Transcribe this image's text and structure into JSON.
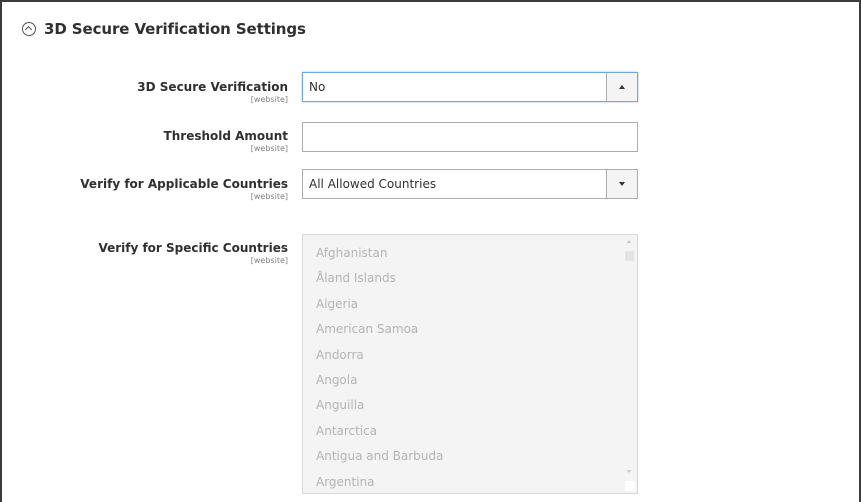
{
  "section": {
    "title": "3D Secure Verification Settings",
    "collapse_icon": "collapse-circle-up-icon"
  },
  "fields": {
    "secure_verification": {
      "label": "3D Secure Verification",
      "scope": "[website]",
      "value": "No",
      "state": "open/focused"
    },
    "threshold_amount": {
      "label": "Threshold Amount",
      "scope": "[website]",
      "value": ""
    },
    "applicable_countries": {
      "label": "Verify for Applicable Countries",
      "scope": "[website]",
      "value": "All Allowed Countries"
    },
    "specific_countries": {
      "label": "Verify for Specific Countries",
      "scope": "[website]",
      "state": "disabled",
      "options": [
        "Afghanistan",
        "Åland Islands",
        "Algeria",
        "American Samoa",
        "Andorra",
        "Angola",
        "Anguilla",
        "Antarctica",
        "Antigua and Barbuda",
        "Argentina"
      ]
    }
  },
  "colors": {
    "focus_border": "#6fa8dc",
    "disabled_bg": "#f4f4f4",
    "disabled_text": "#b4b4b4"
  }
}
